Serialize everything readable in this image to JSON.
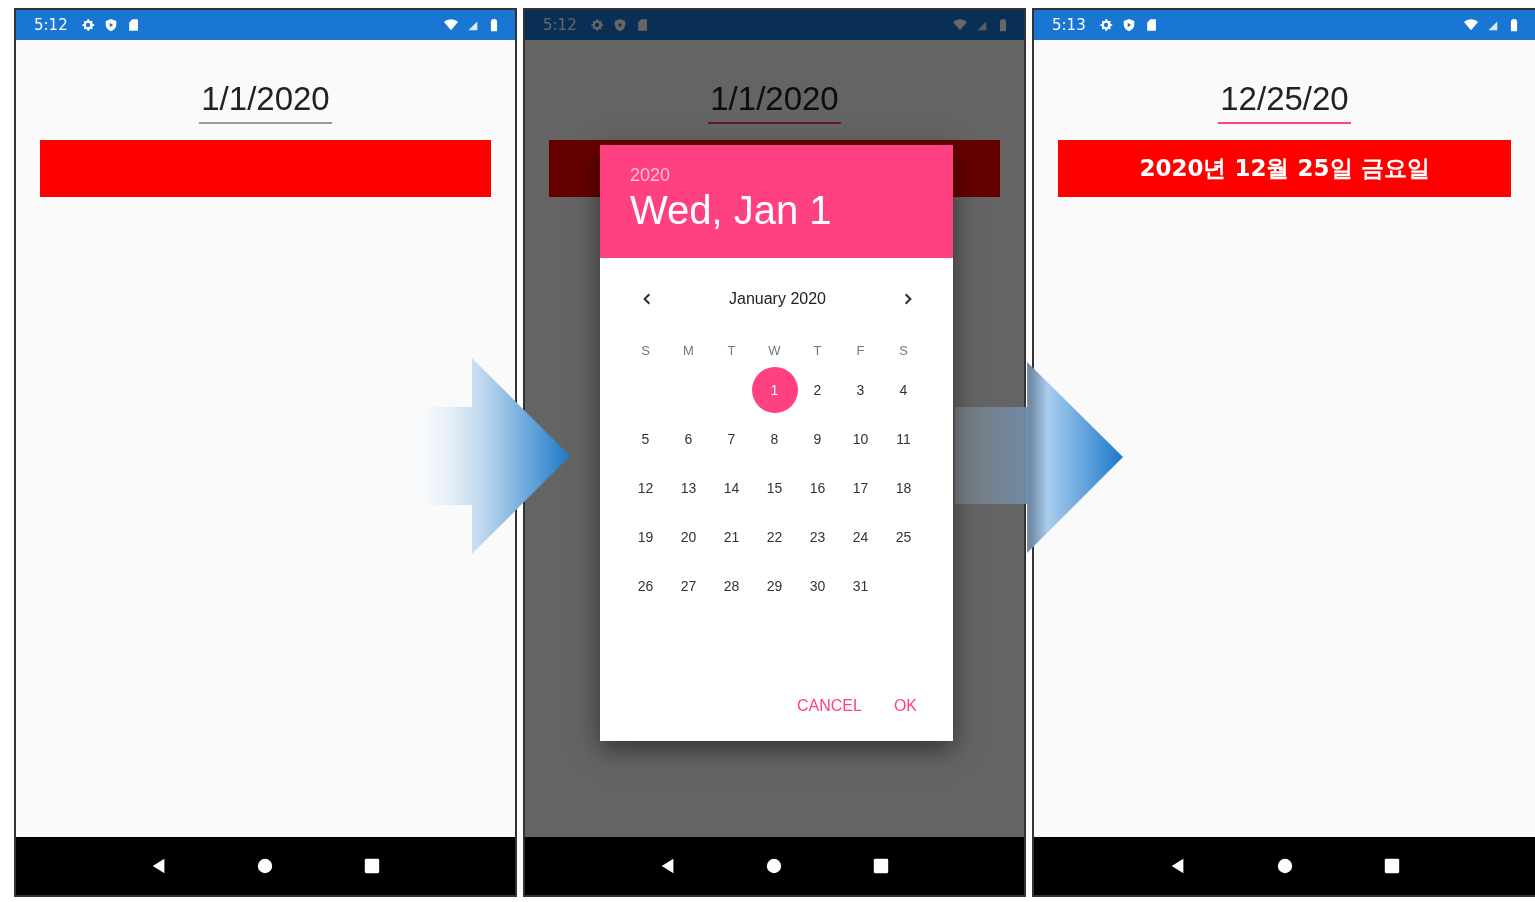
{
  "screens": [
    {
      "status_time": "5:12",
      "dimmed": false,
      "date_field": {
        "value": "1/1/2020",
        "focused": false
      }
    },
    {
      "status_time": "5:12",
      "dimmed": true,
      "date_field": {
        "value": "1/1/2020",
        "focused": true
      },
      "dialog": {
        "year": "2020",
        "headline": "Wed, Jan 1",
        "month": "January 2020",
        "weekdays": [
          "S",
          "M",
          "T",
          "W",
          "T",
          "F",
          "S"
        ],
        "weeks": [
          {
            "days": [
              {
                "label": "1",
                "selected": true
              },
              {
                "label": "2",
                "selected": false
              },
              {
                "label": "3",
                "selected": false
              },
              {
                "label": "4",
                "selected": false
              }
            ]
          },
          {
            "days": [
              {
                "label": "5",
                "selected": false
              },
              {
                "label": "6",
                "selected": false
              },
              {
                "label": "7",
                "selected": false
              },
              {
                "label": "8",
                "selected": false
              },
              {
                "label": "9",
                "selected": false
              },
              {
                "label": "10",
                "selected": false
              },
              {
                "label": "11",
                "selected": false
              }
            ]
          },
          {
            "days": [
              {
                "label": "12",
                "selected": false
              },
              {
                "label": "13",
                "selected": false
              },
              {
                "label": "14",
                "selected": false
              },
              {
                "label": "15",
                "selected": false
              },
              {
                "label": "16",
                "selected": false
              },
              {
                "label": "17",
                "selected": false
              },
              {
                "label": "18",
                "selected": false
              }
            ]
          },
          {
            "days": [
              {
                "label": "19",
                "selected": false
              },
              {
                "label": "20",
                "selected": false
              },
              {
                "label": "21",
                "selected": false
              },
              {
                "label": "22",
                "selected": false
              },
              {
                "label": "23",
                "selected": false
              },
              {
                "label": "24",
                "selected": false
              },
              {
                "label": "25",
                "selected": false
              }
            ]
          },
          {
            "days": [
              {
                "label": "26",
                "selected": false
              },
              {
                "label": "27",
                "selected": false
              },
              {
                "label": "28",
                "selected": false
              },
              {
                "label": "29",
                "selected": false
              },
              {
                "label": "30",
                "selected": false
              },
              {
                "label": "31",
                "selected": false
              }
            ]
          }
        ],
        "buttons": [
          "CANCEL",
          "OK"
        ]
      }
    },
    {
      "status_time": "5:13",
      "dimmed": false,
      "date_field": {
        "value": "12/25/20",
        "focused": true
      },
      "label": {
        "text": "2020년 12월 25일 금요일"
      }
    }
  ]
}
